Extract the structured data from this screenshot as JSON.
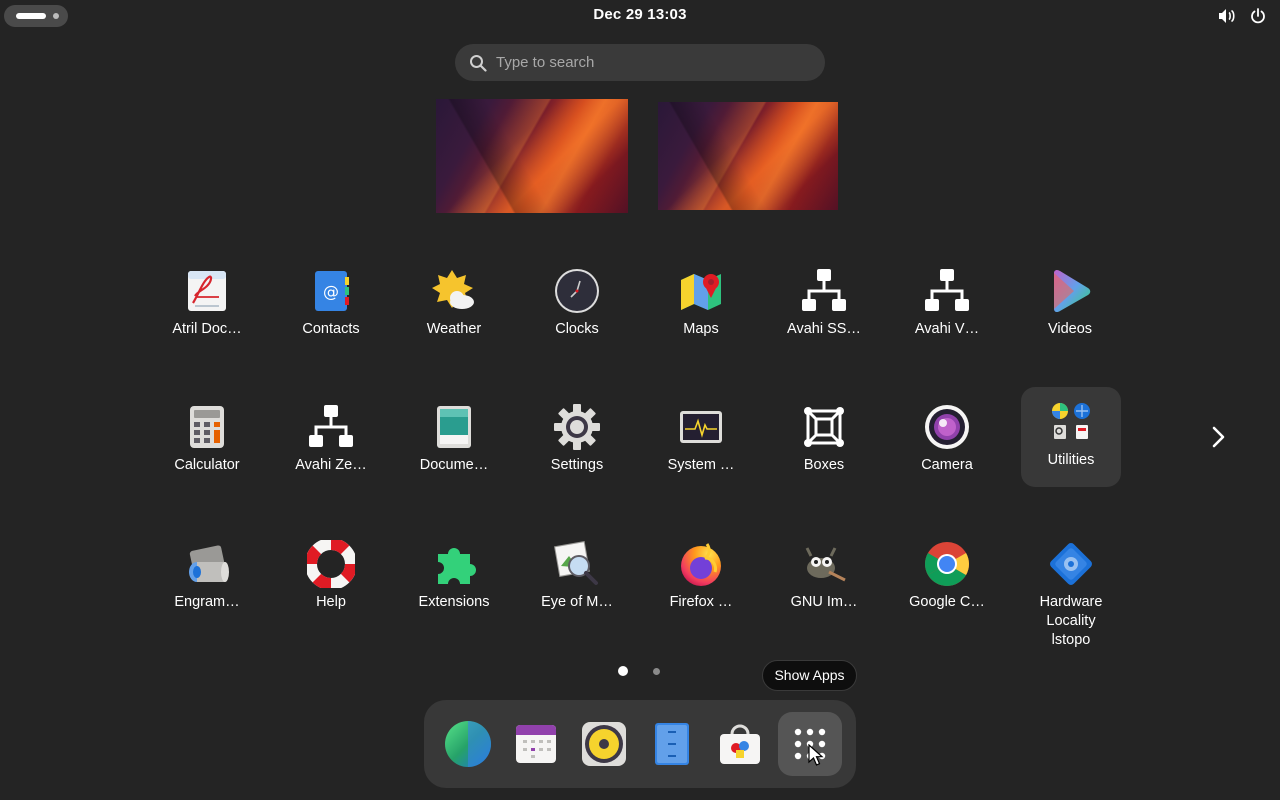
{
  "topbar": {
    "clock": "Dec 29  13:03",
    "icons": [
      "volume-icon",
      "power-icon"
    ]
  },
  "search": {
    "placeholder": "Type to search"
  },
  "app_grid": {
    "rows": [
      [
        "Atril Doc…",
        "Contacts",
        "Weather",
        "Clocks",
        "Maps",
        "Avahi SS…",
        "Avahi V…",
        "Videos"
      ],
      [
        "Calculator",
        "Avahi Ze…",
        "Docume…",
        "Settings",
        "System …",
        "Boxes",
        "Camera",
        "Utilities"
      ],
      [
        "Engram…",
        "Help",
        "Extensions",
        "Eye of M…",
        "Firefox …",
        "GNU Im…",
        "Google C…",
        "Hardware Locality lstopo"
      ]
    ],
    "hardware_locality": [
      "Hardware",
      "Locality",
      "lstopo"
    ],
    "pages": 2,
    "current_page": 1
  },
  "tooltip": {
    "text": "Show Apps"
  },
  "dock": {
    "items": [
      "web-browser-icon",
      "calendar-icon",
      "rhythmbox-icon",
      "files-icon",
      "software-icon",
      "show-apps-icon"
    ]
  },
  "colors": {
    "background": "#242424",
    "surface": "#3a3a3a",
    "dock": "#383838",
    "accent_blue": "#3584e4"
  }
}
